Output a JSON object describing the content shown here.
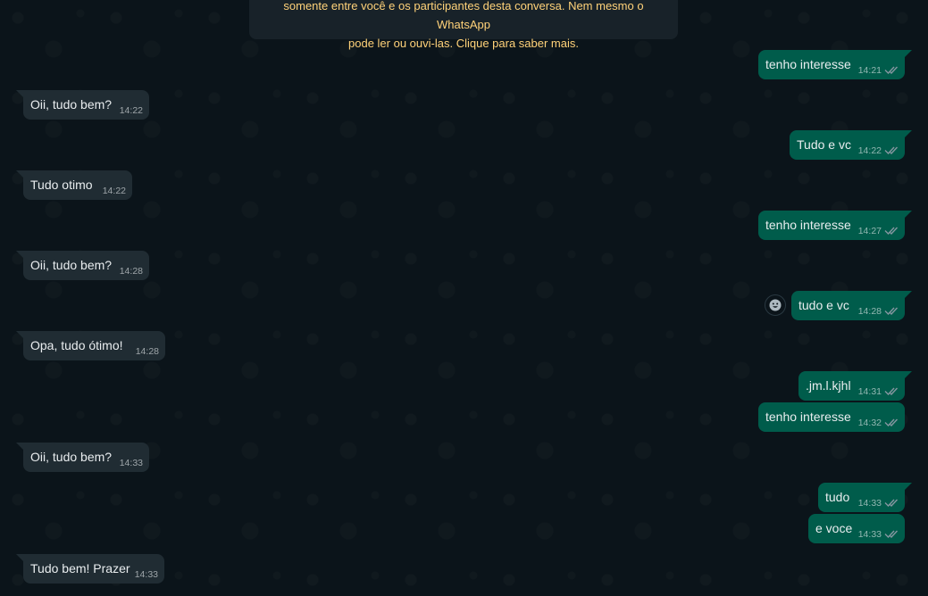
{
  "encryption_notice": {
    "line1": "somente entre você e os participantes desta conversa. Nem mesmo o WhatsApp",
    "line2": "pode ler ou ouvi-las. Clique para saber mais."
  },
  "messages": [
    {
      "direction": "out",
      "text": "tenho interesse",
      "time": "14:21",
      "status": "read"
    },
    {
      "direction": "in",
      "text": "Oii, tudo bem?",
      "time": "14:22"
    },
    {
      "direction": "out",
      "text": "Tudo e vc",
      "time": "14:22",
      "status": "read"
    },
    {
      "direction": "in",
      "text": "Tudo otimo",
      "time": "14:22"
    },
    {
      "direction": "out",
      "text": "tenho interesse",
      "time": "14:27",
      "status": "read"
    },
    {
      "direction": "in",
      "text": "Oii, tudo bem?",
      "time": "14:28"
    },
    {
      "direction": "out",
      "text": "tudo e vc",
      "time": "14:28",
      "status": "read"
    },
    {
      "direction": "in",
      "text": "Opa, tudo ótimo!",
      "time": "14:28"
    },
    {
      "direction": "out",
      "text": ".jm.l.kjhl",
      "time": "14:31",
      "status": "read"
    },
    {
      "direction": "out",
      "text": "tenho interesse",
      "time": "14:32",
      "status": "read"
    },
    {
      "direction": "in",
      "text": "Oii, tudo bem?",
      "time": "14:33"
    },
    {
      "direction": "out",
      "text": "tudo",
      "time": "14:33",
      "status": "read"
    },
    {
      "direction": "out",
      "text": "e voce",
      "time": "14:33",
      "status": "read"
    },
    {
      "direction": "in",
      "text": "Tudo bem! Prazer",
      "time": "14:33"
    }
  ],
  "icons": {
    "read_receipt": "double-check-icon",
    "reaction": "emoji-smile-icon"
  },
  "colors": {
    "chat_background": "#0b141a",
    "incoming_bubble": "#202c33",
    "outgoing_bubble": "#005c4b",
    "notice_text": "#ffd279",
    "read_receipt": "#8696a0"
  }
}
